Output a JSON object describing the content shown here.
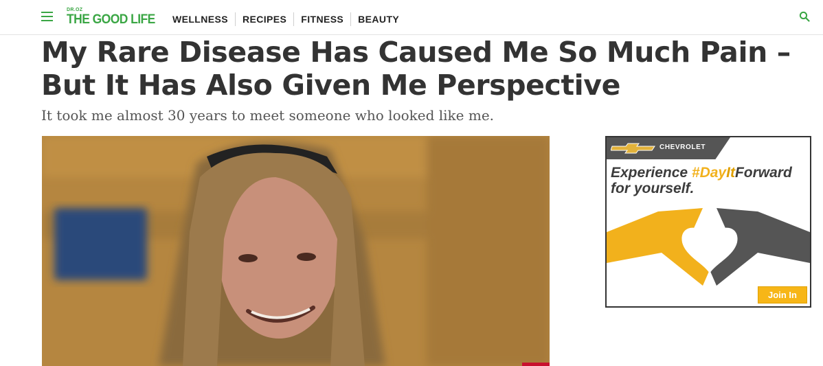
{
  "header": {
    "logo_small": "DR.OZ",
    "logo_big": "THE GOOD LIFE",
    "nav": [
      "WELLNESS",
      "RECIPES",
      "FITNESS",
      "BEAUTY"
    ]
  },
  "article": {
    "title": "My Rare Disease Has Caused Me So Much Pain – But It Has Also Given Me Perspective",
    "subtitle": "It took me almost 30 years to meet someone who looked like me."
  },
  "ad": {
    "brand": "CHEVROLET",
    "line1_prefix": "Experience ",
    "hash": "#Day",
    "hash_it": "It",
    "hash_forward": "Forward",
    "line2": "for yourself.",
    "join": "Join In"
  },
  "colors": {
    "brand_green": "#3aa644",
    "title_text": "#333333",
    "ad_yellow": "#f7b617",
    "ad_dark": "#555555"
  }
}
